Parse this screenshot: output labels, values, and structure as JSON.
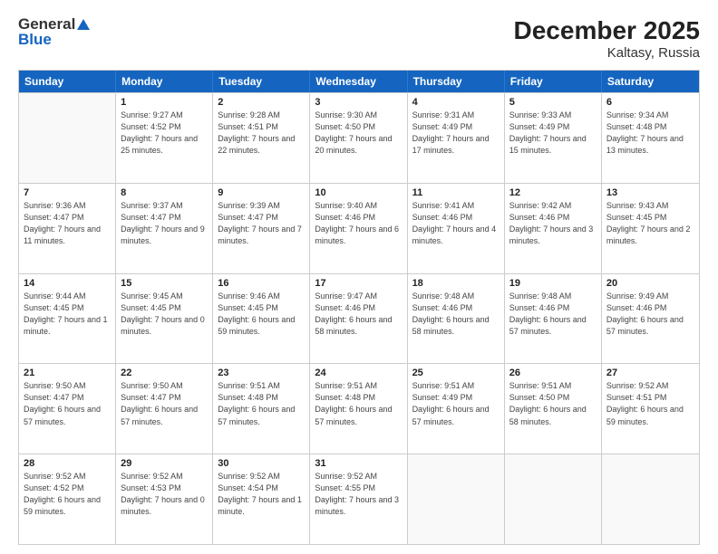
{
  "header": {
    "logo_general": "General",
    "logo_blue": "Blue",
    "title": "December 2025",
    "subtitle": "Kaltasy, Russia"
  },
  "days": [
    "Sunday",
    "Monday",
    "Tuesday",
    "Wednesday",
    "Thursday",
    "Friday",
    "Saturday"
  ],
  "weeks": [
    [
      {
        "date": "",
        "sunrise": "",
        "sunset": "",
        "daylight": "",
        "empty": true
      },
      {
        "date": "1",
        "sunrise": "Sunrise: 9:27 AM",
        "sunset": "Sunset: 4:52 PM",
        "daylight": "Daylight: 7 hours and 25 minutes."
      },
      {
        "date": "2",
        "sunrise": "Sunrise: 9:28 AM",
        "sunset": "Sunset: 4:51 PM",
        "daylight": "Daylight: 7 hours and 22 minutes."
      },
      {
        "date": "3",
        "sunrise": "Sunrise: 9:30 AM",
        "sunset": "Sunset: 4:50 PM",
        "daylight": "Daylight: 7 hours and 20 minutes."
      },
      {
        "date": "4",
        "sunrise": "Sunrise: 9:31 AM",
        "sunset": "Sunset: 4:49 PM",
        "daylight": "Daylight: 7 hours and 17 minutes."
      },
      {
        "date": "5",
        "sunrise": "Sunrise: 9:33 AM",
        "sunset": "Sunset: 4:49 PM",
        "daylight": "Daylight: 7 hours and 15 minutes."
      },
      {
        "date": "6",
        "sunrise": "Sunrise: 9:34 AM",
        "sunset": "Sunset: 4:48 PM",
        "daylight": "Daylight: 7 hours and 13 minutes."
      }
    ],
    [
      {
        "date": "7",
        "sunrise": "Sunrise: 9:36 AM",
        "sunset": "Sunset: 4:47 PM",
        "daylight": "Daylight: 7 hours and 11 minutes."
      },
      {
        "date": "8",
        "sunrise": "Sunrise: 9:37 AM",
        "sunset": "Sunset: 4:47 PM",
        "daylight": "Daylight: 7 hours and 9 minutes."
      },
      {
        "date": "9",
        "sunrise": "Sunrise: 9:39 AM",
        "sunset": "Sunset: 4:47 PM",
        "daylight": "Daylight: 7 hours and 7 minutes."
      },
      {
        "date": "10",
        "sunrise": "Sunrise: 9:40 AM",
        "sunset": "Sunset: 4:46 PM",
        "daylight": "Daylight: 7 hours and 6 minutes."
      },
      {
        "date": "11",
        "sunrise": "Sunrise: 9:41 AM",
        "sunset": "Sunset: 4:46 PM",
        "daylight": "Daylight: 7 hours and 4 minutes."
      },
      {
        "date": "12",
        "sunrise": "Sunrise: 9:42 AM",
        "sunset": "Sunset: 4:46 PM",
        "daylight": "Daylight: 7 hours and 3 minutes."
      },
      {
        "date": "13",
        "sunrise": "Sunrise: 9:43 AM",
        "sunset": "Sunset: 4:45 PM",
        "daylight": "Daylight: 7 hours and 2 minutes."
      }
    ],
    [
      {
        "date": "14",
        "sunrise": "Sunrise: 9:44 AM",
        "sunset": "Sunset: 4:45 PM",
        "daylight": "Daylight: 7 hours and 1 minute."
      },
      {
        "date": "15",
        "sunrise": "Sunrise: 9:45 AM",
        "sunset": "Sunset: 4:45 PM",
        "daylight": "Daylight: 7 hours and 0 minutes."
      },
      {
        "date": "16",
        "sunrise": "Sunrise: 9:46 AM",
        "sunset": "Sunset: 4:45 PM",
        "daylight": "Daylight: 6 hours and 59 minutes."
      },
      {
        "date": "17",
        "sunrise": "Sunrise: 9:47 AM",
        "sunset": "Sunset: 4:46 PM",
        "daylight": "Daylight: 6 hours and 58 minutes."
      },
      {
        "date": "18",
        "sunrise": "Sunrise: 9:48 AM",
        "sunset": "Sunset: 4:46 PM",
        "daylight": "Daylight: 6 hours and 58 minutes."
      },
      {
        "date": "19",
        "sunrise": "Sunrise: 9:48 AM",
        "sunset": "Sunset: 4:46 PM",
        "daylight": "Daylight: 6 hours and 57 minutes."
      },
      {
        "date": "20",
        "sunrise": "Sunrise: 9:49 AM",
        "sunset": "Sunset: 4:46 PM",
        "daylight": "Daylight: 6 hours and 57 minutes."
      }
    ],
    [
      {
        "date": "21",
        "sunrise": "Sunrise: 9:50 AM",
        "sunset": "Sunset: 4:47 PM",
        "daylight": "Daylight: 6 hours and 57 minutes."
      },
      {
        "date": "22",
        "sunrise": "Sunrise: 9:50 AM",
        "sunset": "Sunset: 4:47 PM",
        "daylight": "Daylight: 6 hours and 57 minutes."
      },
      {
        "date": "23",
        "sunrise": "Sunrise: 9:51 AM",
        "sunset": "Sunset: 4:48 PM",
        "daylight": "Daylight: 6 hours and 57 minutes."
      },
      {
        "date": "24",
        "sunrise": "Sunrise: 9:51 AM",
        "sunset": "Sunset: 4:48 PM",
        "daylight": "Daylight: 6 hours and 57 minutes."
      },
      {
        "date": "25",
        "sunrise": "Sunrise: 9:51 AM",
        "sunset": "Sunset: 4:49 PM",
        "daylight": "Daylight: 6 hours and 57 minutes."
      },
      {
        "date": "26",
        "sunrise": "Sunrise: 9:51 AM",
        "sunset": "Sunset: 4:50 PM",
        "daylight": "Daylight: 6 hours and 58 minutes."
      },
      {
        "date": "27",
        "sunrise": "Sunrise: 9:52 AM",
        "sunset": "Sunset: 4:51 PM",
        "daylight": "Daylight: 6 hours and 59 minutes."
      }
    ],
    [
      {
        "date": "28",
        "sunrise": "Sunrise: 9:52 AM",
        "sunset": "Sunset: 4:52 PM",
        "daylight": "Daylight: 6 hours and 59 minutes."
      },
      {
        "date": "29",
        "sunrise": "Sunrise: 9:52 AM",
        "sunset": "Sunset: 4:53 PM",
        "daylight": "Daylight: 7 hours and 0 minutes."
      },
      {
        "date": "30",
        "sunrise": "Sunrise: 9:52 AM",
        "sunset": "Sunset: 4:54 PM",
        "daylight": "Daylight: 7 hours and 1 minute."
      },
      {
        "date": "31",
        "sunrise": "Sunrise: 9:52 AM",
        "sunset": "Sunset: 4:55 PM",
        "daylight": "Daylight: 7 hours and 3 minutes."
      },
      {
        "date": "",
        "empty": true
      },
      {
        "date": "",
        "empty": true
      },
      {
        "date": "",
        "empty": true
      }
    ]
  ]
}
